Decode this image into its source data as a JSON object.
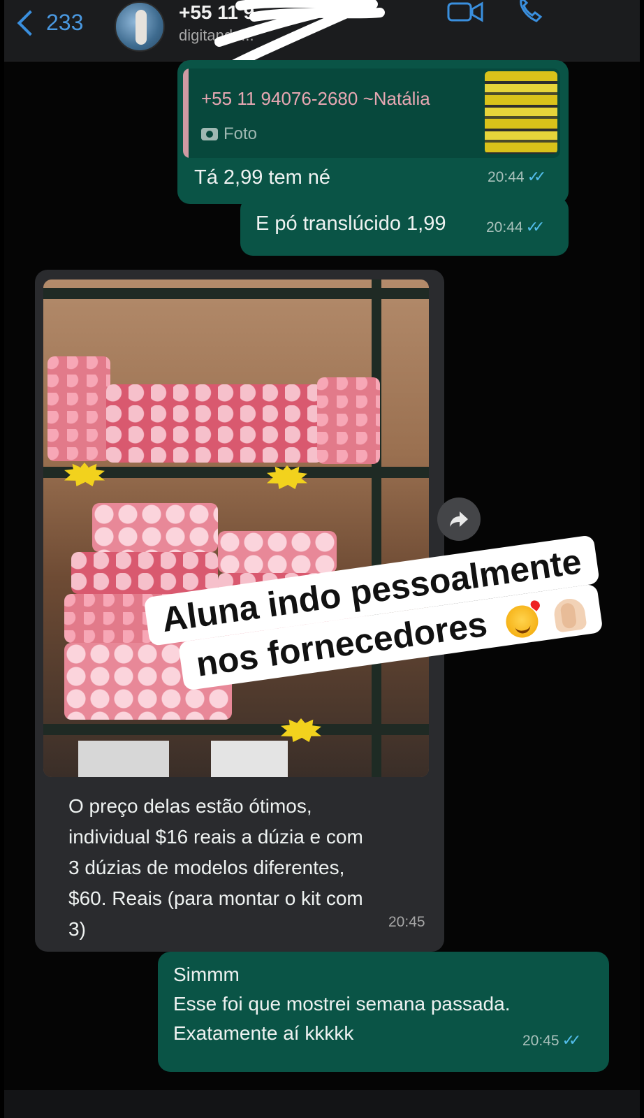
{
  "header": {
    "back_count": "233",
    "contact_name": "+55 11 9",
    "status": "digitando..."
  },
  "messages": {
    "m1": {
      "quote_author": "+55 11 94076-2680  ~Natália",
      "quote_type": "Foto",
      "text": "Tá 2,99 tem né",
      "time": "20:44"
    },
    "m2": {
      "text": "E pó translúcido 1,99",
      "time": "20:44"
    },
    "m3": {
      "line1": "O preço delas estão ótimos,",
      "line2": "individual $16 reais a dúzia  e com",
      "line3": "3 dúzias de modelos diferentes,",
      "line4": "$60. Reais (para montar o kit com",
      "line5": "3)",
      "time": "20:45"
    },
    "m4": {
      "line1": "Simmm",
      "line2": "Esse foi que mostrei semana passada.",
      "line3": "Exatamente aí kkkkk",
      "time": "20:45"
    }
  },
  "sticker": {
    "line1": "Aluna indo pessoalmente",
    "line2": "nos fornecedores"
  },
  "colors": {
    "outgoing_bubble": "#0a5446",
    "incoming_bubble": "#2a2b2e",
    "read_ticks": "#53bdeb",
    "link_blue": "#3a8fde"
  },
  "icons": [
    "chevron-left-icon",
    "video-call-icon",
    "phone-call-icon",
    "camera-icon",
    "read-receipt-icon",
    "forward-icon",
    "smiling-hearts-emoji",
    "clapping-hands-emoji"
  ]
}
